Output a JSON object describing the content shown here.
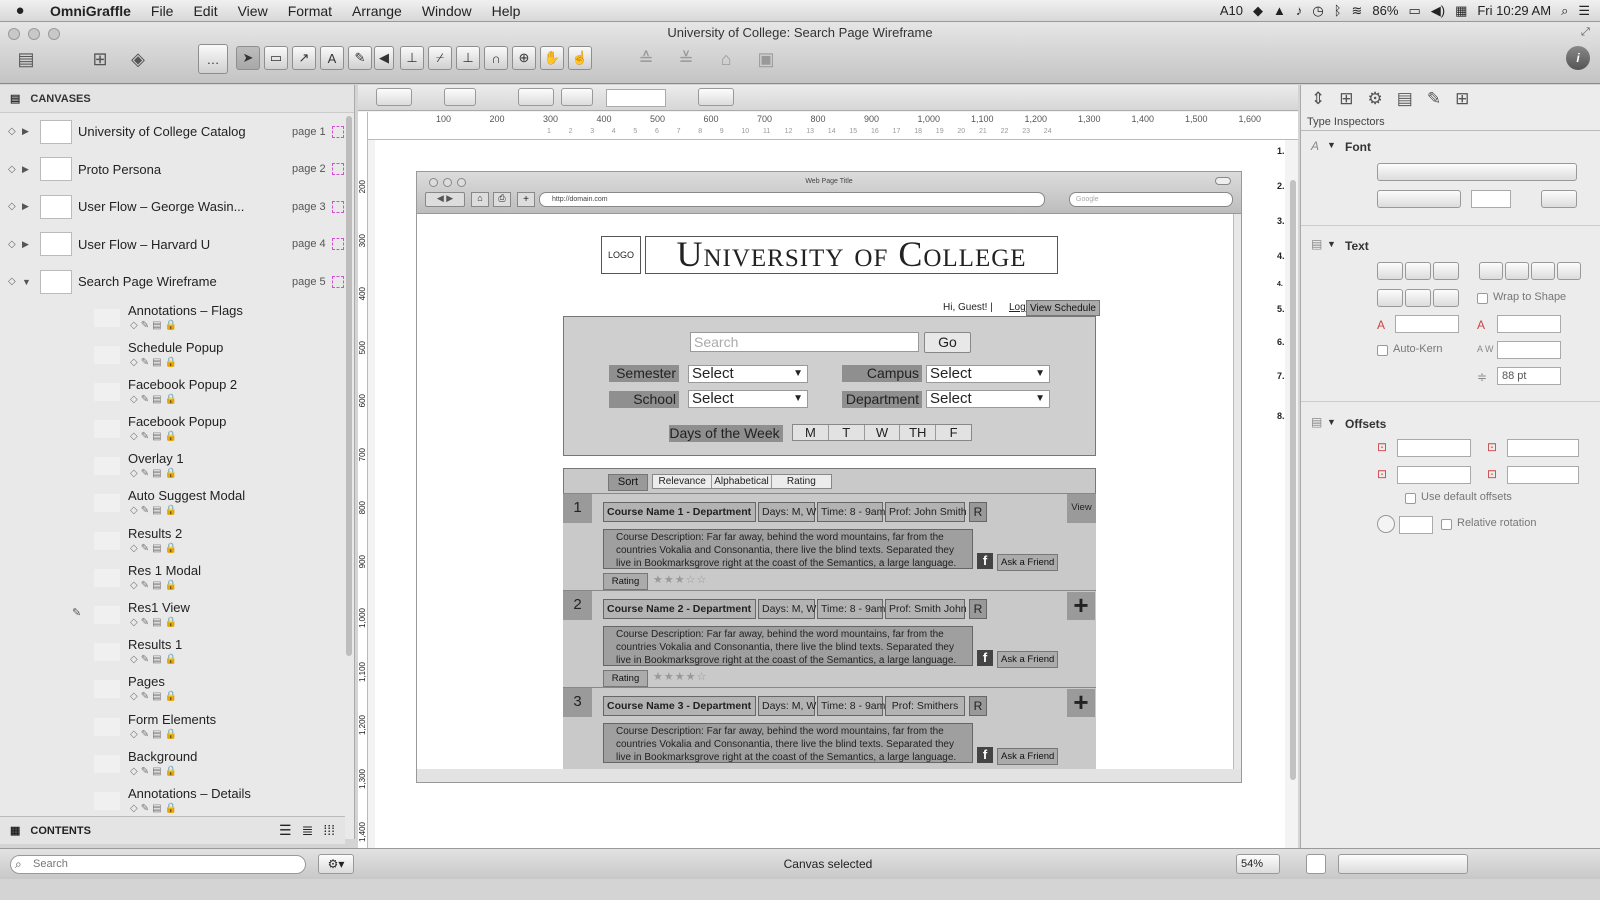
{
  "menubar": {
    "app": "OmniGraffle",
    "items": [
      "File",
      "Edit",
      "View",
      "Format",
      "Arrange",
      "Window",
      "Help"
    ],
    "status": {
      "adobe": "10",
      "battery": "86%",
      "clock": "Fri 10:29 AM"
    }
  },
  "window": {
    "title": "University of College: Search Page Wireframe"
  },
  "sidebar": {
    "canvases_header": "CANVASES",
    "canvases": [
      {
        "name": "University of College Catalog",
        "page": "page 1"
      },
      {
        "name": "Proto Persona",
        "page": "page 2"
      },
      {
        "name": "User Flow – George Wasin...",
        "page": "page 3"
      },
      {
        "name": "User Flow – Harvard U",
        "page": "page 4"
      },
      {
        "name": "Search Page Wireframe",
        "page": "page 5"
      }
    ],
    "layers": [
      "Annotations – Flags",
      "Schedule Popup",
      "Facebook Popup 2",
      "Facebook Popup",
      "Overlay 1",
      "Auto Suggest Modal",
      "Results 2",
      "Res 1 Modal",
      "Res1 View",
      "Results 1",
      "Pages",
      "Form Elements",
      "Background",
      "Annotations – Details"
    ],
    "contents_header": "CONTENTS",
    "search_placeholder": "Search"
  },
  "ruler": {
    "major": [
      "100",
      "200",
      "300",
      "400",
      "500",
      "600",
      "700",
      "800",
      "900",
      "1,000",
      "1,100",
      "1,200",
      "1,300",
      "1,400",
      "1,500",
      "1,600"
    ],
    "minor": [
      "1",
      "2",
      "3",
      "4",
      "5",
      "6",
      "7",
      "8",
      "9",
      "10",
      "11",
      "12",
      "13",
      "14",
      "15",
      "16",
      "17",
      "18",
      "19",
      "20",
      "21",
      "22",
      "23",
      "24"
    ]
  },
  "vruler": [
    "200",
    "300",
    "400",
    "500",
    "600",
    "700",
    "800",
    "900",
    "1,000",
    "1,100",
    "1,200",
    "1,300",
    "1,400"
  ],
  "annotations": [
    "1.",
    "2.",
    "3.",
    "4.",
    "4.",
    "5.",
    "6.",
    "7.",
    "8."
  ],
  "status": {
    "text": "Canvas selected",
    "zoom": "54%"
  },
  "inspector": {
    "title": "Type Inspectors",
    "font": "Font",
    "text": "Text",
    "wrap": "Wrap to Shape",
    "autokern": "Auto-Kern",
    "size": "88 pt",
    "offsets": "Offsets",
    "default_offsets": "Use default offsets",
    "relative_rotation": "Relative rotation"
  },
  "wireframe": {
    "page_title": "Web Page Title",
    "url": "http://domain.com",
    "google": "Google",
    "logo": "LOGO",
    "university": "University of College",
    "greeting": "Hi, Guest! |",
    "login": "Login",
    "view_schedule": "View Schedule",
    "search_placeholder": "Search",
    "go": "Go",
    "semester": "Semester",
    "campus": "Campus",
    "school": "School",
    "department": "Department",
    "select": "Select",
    "days_label": "Days of the Week",
    "days": [
      "M",
      "T",
      "W",
      "TH",
      "F"
    ],
    "sort": "Sort",
    "sort_options": [
      "Relevance",
      "Alphabetical",
      "Rating"
    ],
    "view": "View",
    "rating": "Rating",
    "ask": "Ask a Friend",
    "r": "R",
    "description": "Course Description: Far far away, behind the word mountains, far from the countries Vokalia and Consonantia, there live the blind texts. Separated they live in Bookmarksgrove right at the coast of the Semantics, a large language.",
    "results": [
      {
        "num": "1",
        "name": "Course Name 1 - Department",
        "days": "Days: M, W",
        "time": "Time: 8 - 9am",
        "prof": "Prof: John Smith",
        "stars": "★★★☆☆"
      },
      {
        "num": "2",
        "name": "Course Name 2 - Department",
        "days": "Days: M, W",
        "time": "Time: 8 - 9am",
        "prof": "Prof: Smith John",
        "stars": "★★★★☆"
      },
      {
        "num": "3",
        "name": "Course Name 3 - Department",
        "days": "Days: M, W",
        "time": "Time: 8 - 9am",
        "prof": "Prof: Smithers"
      }
    ]
  }
}
